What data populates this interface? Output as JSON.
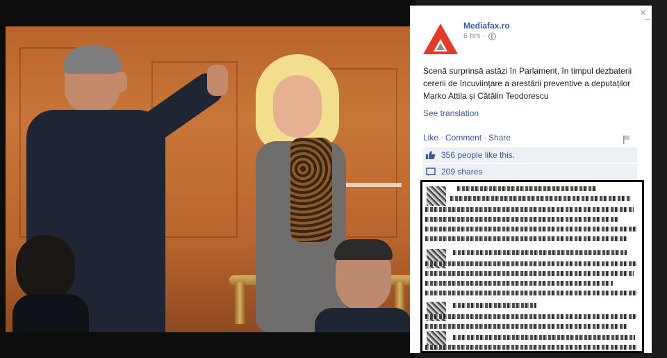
{
  "post": {
    "page_name": "Mediafax.ro",
    "time": "6 hrs",
    "privacy_icon": "globe-icon",
    "text": "Scenă surprinsă astăzi în Parlament, în timpul dezbaterii cererii de încuviințare a arestării preventive a deputaților Marko Attila și Cătălin Teodorescu",
    "see_translation": "See translation"
  },
  "actions": {
    "like": "Like",
    "comment": "Comment",
    "share": "Share",
    "separator": "·"
  },
  "stats": {
    "likes": "356 people like this.",
    "shares": "209 shares"
  },
  "colors": {
    "brand_link": "#3b5998",
    "logo_red": "#e53a2a",
    "logo_gray": "#8e8e8e"
  },
  "window": {
    "close": "×"
  }
}
